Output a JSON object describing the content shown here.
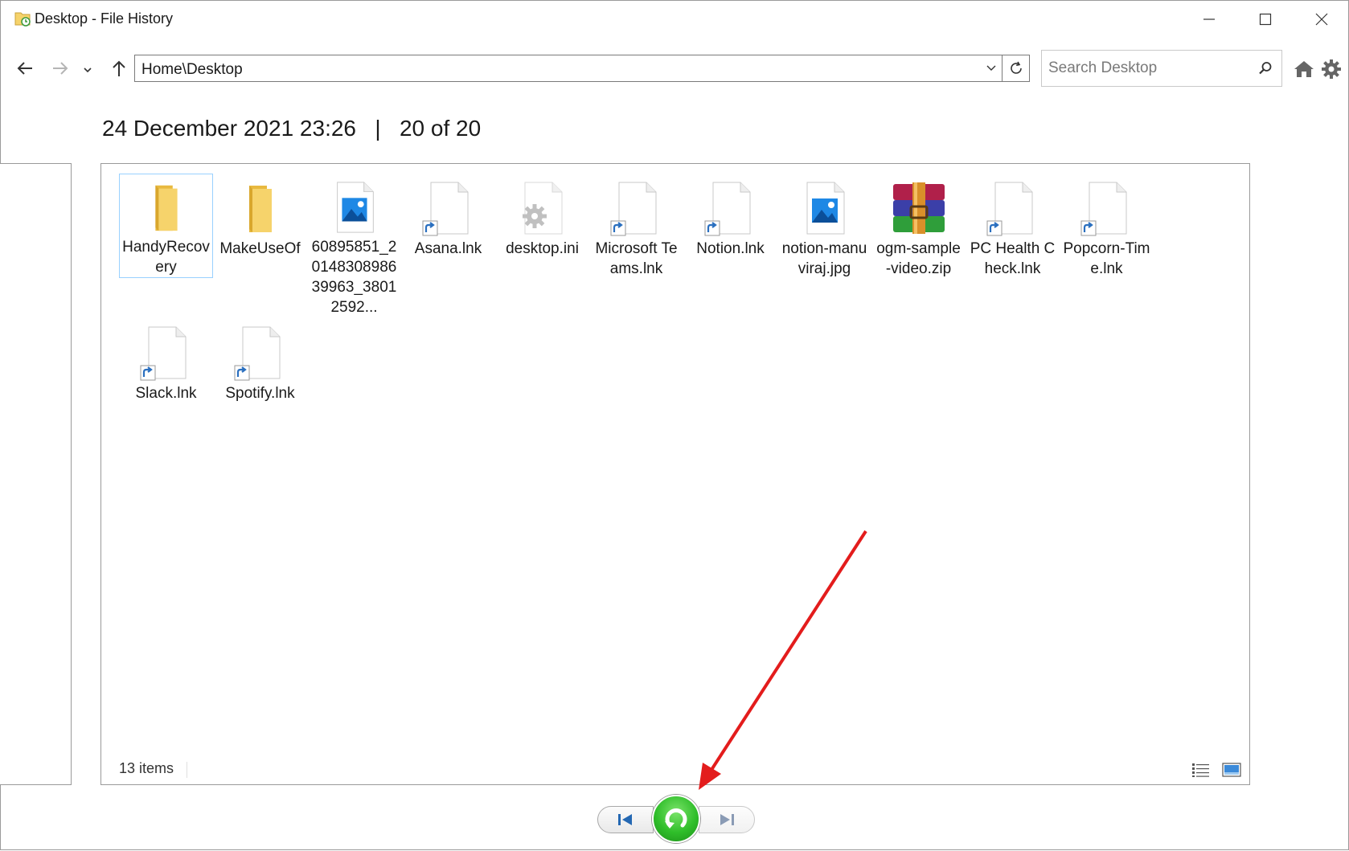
{
  "window": {
    "title": "Desktop - File History"
  },
  "nav": {
    "address": "Home\\Desktop",
    "search_placeholder": "Search Desktop"
  },
  "header": {
    "date": "24 December 2021 23:26",
    "separator": "|",
    "version": "20 of 20"
  },
  "files": [
    {
      "name": "HandyRecovery",
      "type": "folder-icon",
      "selected": true
    },
    {
      "name": "MakeUseOf",
      "type": "folder-icon"
    },
    {
      "name": "60895851_2014830898639963_38012592...",
      "type": "image-file-icon"
    },
    {
      "name": "Asana.lnk",
      "type": "shortcut-file-icon"
    },
    {
      "name": "desktop.ini",
      "type": "settings-file-icon"
    },
    {
      "name": "Microsoft Teams.lnk",
      "type": "shortcut-file-icon"
    },
    {
      "name": "Notion.lnk",
      "type": "shortcut-file-icon"
    },
    {
      "name": "notion-manuviraj.jpg",
      "type": "image-file-icon"
    },
    {
      "name": "ogm-sample-video.zip",
      "type": "archive-file-icon"
    },
    {
      "name": "PC Health Check.lnk",
      "type": "shortcut-file-icon"
    },
    {
      "name": "Popcorn-Time.lnk",
      "type": "shortcut-file-icon"
    },
    {
      "name": "Slack.lnk",
      "type": "shortcut-file-icon"
    },
    {
      "name": "Spotify.lnk",
      "type": "shortcut-file-icon"
    }
  ],
  "status": {
    "count": "13 items"
  },
  "colors": {
    "folder": "#f6d36b",
    "shortcut_arrow": "#2a6fbf",
    "restore_green": "#2fbe2a",
    "annotation_arrow": "#e31c1c",
    "selection_border": "#99d1ff"
  }
}
